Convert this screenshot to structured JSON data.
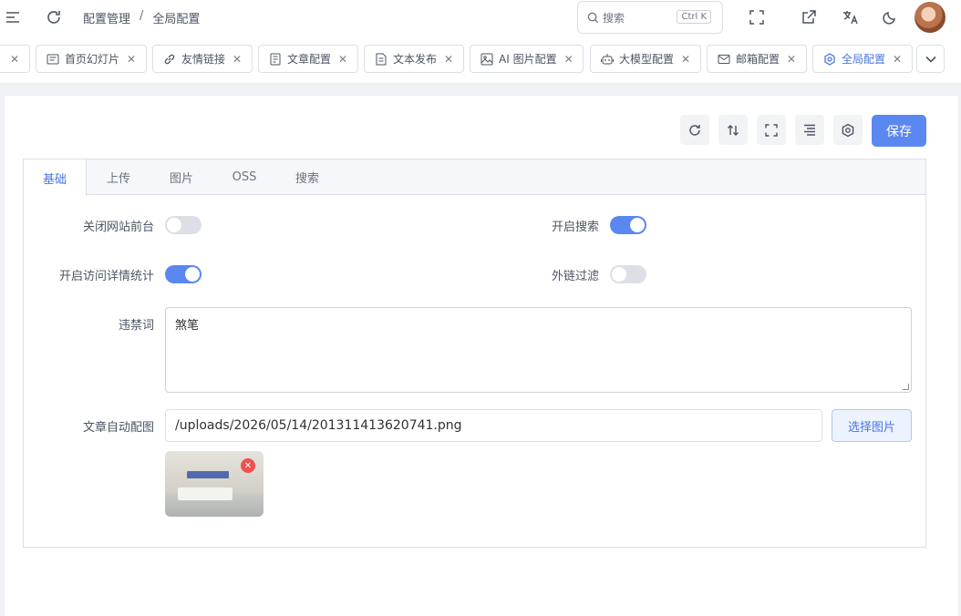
{
  "header": {
    "breadcrumb": [
      "配置管理",
      "/",
      "全局配置"
    ],
    "search": {
      "placeholder": "搜索",
      "shortcut": "Ctrl K"
    }
  },
  "tabs": [
    {
      "label": "首页幻灯片",
      "icon": "slides-icon"
    },
    {
      "label": "友情链接",
      "icon": "link-icon"
    },
    {
      "label": "文章配置",
      "icon": "document-icon"
    },
    {
      "label": "文本发布",
      "icon": "file-text-icon"
    },
    {
      "label": "AI 图片配置",
      "icon": "image-icon"
    },
    {
      "label": "大模型配置",
      "icon": "robot-icon"
    },
    {
      "label": "邮箱配置",
      "icon": "mail-icon"
    },
    {
      "label": "全局配置",
      "icon": "gear-icon",
      "active": true
    }
  ],
  "toolbar": {
    "save_label": "保存"
  },
  "panel_tabs": [
    "基础",
    "上传",
    "图片",
    "OSS",
    "搜索"
  ],
  "form": {
    "close_site_label": "关闭网站前台",
    "close_site_on": false,
    "search_label": "开启搜索",
    "search_on": true,
    "visit_stats_label": "开启访问详情统计",
    "visit_stats_on": true,
    "link_filter_label": "外链过滤",
    "link_filter_on": false,
    "banned_words_label": "违禁词",
    "banned_words_value": "煞笔",
    "auto_image_label": "文章自动配图",
    "auto_image_value": "/uploads/2026/05/14/201311413620741.png",
    "pick_image_label": "选择图片"
  },
  "colors": {
    "primary": "#5b87f0",
    "danger": "#f0504f"
  }
}
